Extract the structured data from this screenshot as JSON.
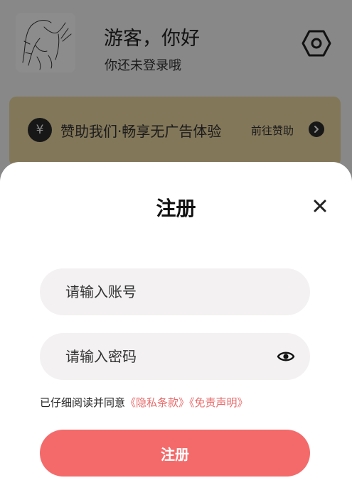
{
  "profile": {
    "greeting": "游客，你好",
    "subtext": "你还未登录哦",
    "avatar_icon": "sketch-avatar-icon",
    "settings_icon": "hexagon-settings-icon"
  },
  "sponsor": {
    "icon_symbol": "¥",
    "text": "赞助我们·畅享无广告体验",
    "link_label": "前往赞助",
    "bg_color": "#eed9a4"
  },
  "register_sheet": {
    "title": "注册",
    "close_icon": "close-icon",
    "account_placeholder": "请输入账号",
    "password_placeholder": "请输入密码",
    "eye_icon": "eye-icon",
    "agreement_prefix": "已仔细阅读并同意",
    "privacy_link": "《隐私条款》",
    "disclaimer_link": "《免责声明》",
    "submit_label": "注册",
    "accent_color": "#f46a6a"
  }
}
